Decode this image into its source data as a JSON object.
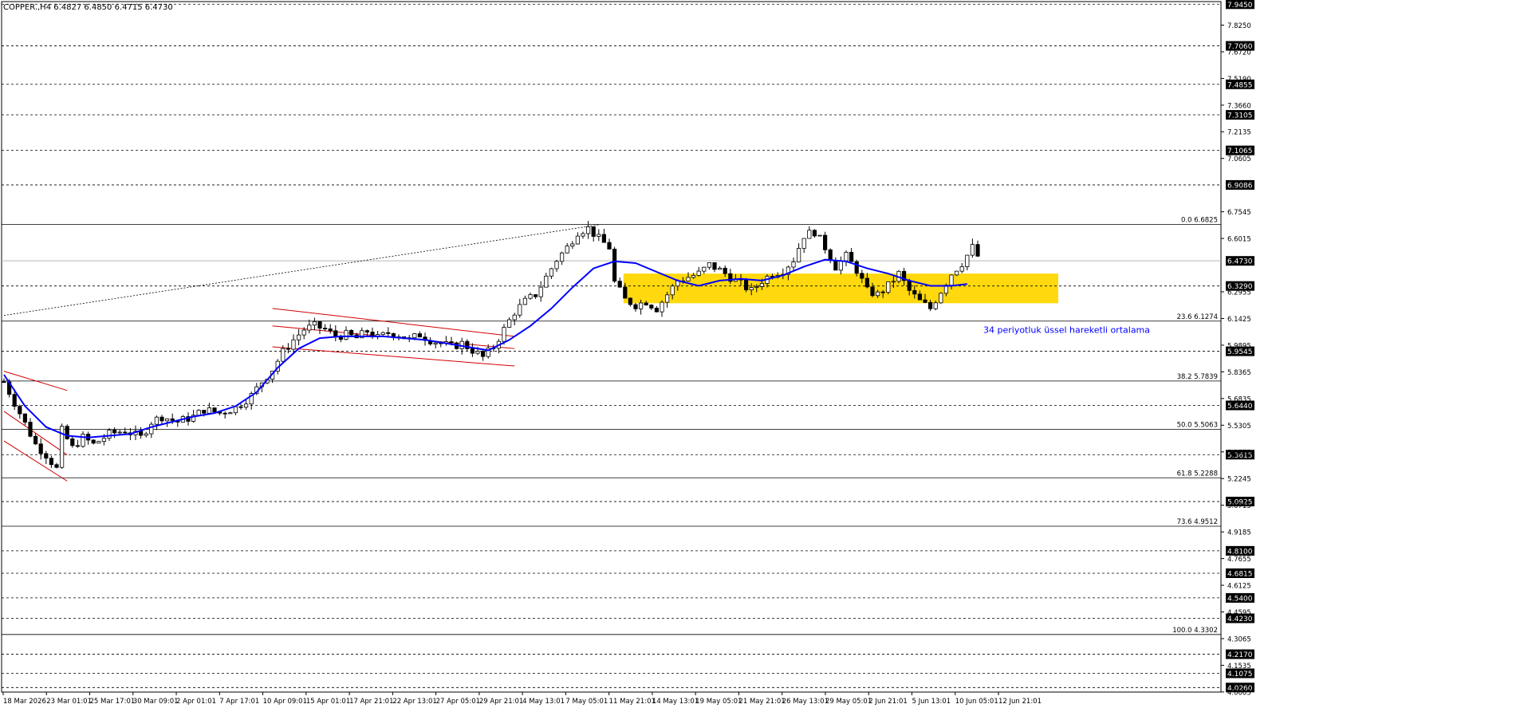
{
  "chart_data": {
    "type": "candlestick",
    "symbol_line": "COPPER.,H4 6.4827 6.4850 6.4715 6.4730",
    "ylim": [
      4.0,
      7.96
    ],
    "x_tick_labels": [
      "18 Mar 2026",
      "23 Mar 01:01",
      "25 Mar 17:01",
      "30 Mar 09:01",
      "2 Apr 01:01",
      "7 Apr 17:01",
      "10 Apr 09:01",
      "15 Apr 01:01",
      "17 Apr 21:01",
      "22 Apr 13:01",
      "27 Apr 05:01",
      "29 Apr 21:01",
      "4 May 13:01",
      "7 May 05:01",
      "11 May 21:01",
      "14 May 13:01",
      "19 May 05:01",
      "21 May 21:01",
      "26 May 13:01",
      "29 May 05:01",
      "2 Jun 21:01",
      "5 Jun 13:01",
      "10 Jun 05:01",
      "12 Jun 21:01"
    ],
    "y_tick_labels": [
      7.825,
      7.672,
      7.519,
      7.366,
      7.2135,
      7.0605,
      6.7545,
      6.6015,
      6.2955,
      6.1425,
      5.9895,
      5.8365,
      5.6835,
      5.5305,
      5.3775,
      5.2245,
      5.0715,
      4.9185,
      4.7655,
      4.6125,
      4.4595,
      4.3065,
      4.1535,
      4.0005
    ],
    "horizontal_levels": [
      {
        "value": 7.945,
        "label": "7.9450",
        "style": "dashed"
      },
      {
        "value": 7.706,
        "label": "7.7060",
        "style": "dashed"
      },
      {
        "value": 7.4855,
        "label": "7.4855",
        "style": "dashed"
      },
      {
        "value": 7.3105,
        "label": "7.3105",
        "style": "dashed"
      },
      {
        "value": 7.1065,
        "label": "7.1065",
        "style": "dashed"
      },
      {
        "value": 6.9086,
        "label": "6.9086",
        "style": "dashed"
      },
      {
        "value": 6.329,
        "label": "6.3290",
        "style": "dashed"
      },
      {
        "value": 5.9545,
        "label": "5.9545",
        "style": "dashed"
      },
      {
        "value": 5.644,
        "label": "5.6440",
        "style": "dashed"
      },
      {
        "value": 5.3615,
        "label": "5.3615",
        "style": "dashed"
      },
      {
        "value": 5.0925,
        "label": "5.0925",
        "style": "dashed"
      },
      {
        "value": 4.81,
        "label": "4.8100",
        "style": "dashed"
      },
      {
        "value": 4.6815,
        "label": "4.6815",
        "style": "dashed"
      },
      {
        "value": 4.54,
        "label": "4.5400",
        "style": "dashed"
      },
      {
        "value": 4.423,
        "label": "4.4230",
        "style": "dashed"
      },
      {
        "value": 4.217,
        "label": "4.2170",
        "style": "dashed"
      },
      {
        "value": 4.1075,
        "label": "4.1075",
        "style": "dashed"
      },
      {
        "value": 4.026,
        "label": "4.0260",
        "style": "dashed"
      }
    ],
    "fibonacci": [
      {
        "value": 6.6825,
        "label": "0.0 6.6825"
      },
      {
        "value": 6.1274,
        "label": "23.6 6.1274"
      },
      {
        "value": 5.7839,
        "label": "38.2 5.7839"
      },
      {
        "value": 5.5063,
        "label": "50.0 5.5063"
      },
      {
        "value": 5.2288,
        "label": "61.8 5.2288"
      },
      {
        "value": 4.9512,
        "label": "73.6 4.9512"
      },
      {
        "value": 4.3302,
        "label": "100.0 4.3302"
      }
    ],
    "last_price": {
      "value": 6.473,
      "label": "6.4730"
    },
    "ema_annotation": "34 periyotluk üssel hareketli ortalama",
    "close_path": [
      [
        0,
        5.78
      ],
      [
        3,
        5.6
      ],
      [
        6,
        5.42
      ],
      [
        8,
        5.36
      ],
      [
        10,
        5.28
      ],
      [
        11,
        5.5
      ],
      [
        13,
        5.4
      ],
      [
        15,
        5.46
      ],
      [
        17,
        5.42
      ],
      [
        20,
        5.48
      ],
      [
        23,
        5.5
      ],
      [
        26,
        5.46
      ],
      [
        28,
        5.55
      ],
      [
        30,
        5.58
      ],
      [
        33,
        5.55
      ],
      [
        36,
        5.58
      ],
      [
        38,
        5.62
      ],
      [
        41,
        5.6
      ],
      [
        44,
        5.63
      ],
      [
        47,
        5.7
      ],
      [
        49,
        5.78
      ],
      [
        51,
        5.85
      ],
      [
        53,
        5.95
      ],
      [
        55,
        6.02
      ],
      [
        57,
        6.08
      ],
      [
        59,
        6.1
      ],
      [
        61,
        6.08
      ],
      [
        63,
        6.04
      ],
      [
        65,
        6.05
      ],
      [
        67,
        6.03
      ],
      [
        69,
        6.07
      ],
      [
        71,
        6.03
      ],
      [
        73,
        6.06
      ],
      [
        75,
        6.05
      ],
      [
        77,
        6.02
      ],
      [
        79,
        6.05
      ],
      [
        81,
        6.02
      ],
      [
        83,
        6.0
      ],
      [
        85,
        5.98
      ],
      [
        87,
        6.0
      ],
      [
        89,
        5.96
      ],
      [
        91,
        5.92
      ],
      [
        93,
        5.98
      ],
      [
        95,
        6.08
      ],
      [
        97,
        6.18
      ],
      [
        99,
        6.24
      ],
      [
        101,
        6.28
      ],
      [
        103,
        6.38
      ],
      [
        105,
        6.48
      ],
      [
        107,
        6.55
      ],
      [
        109,
        6.64
      ],
      [
        111,
        6.66
      ],
      [
        113,
        6.6
      ],
      [
        115,
        6.55
      ],
      [
        116,
        6.35
      ],
      [
        118,
        6.25
      ],
      [
        120,
        6.22
      ],
      [
        122,
        6.24
      ],
      [
        124,
        6.2
      ],
      [
        126,
        6.28
      ],
      [
        128,
        6.36
      ],
      [
        130,
        6.38
      ],
      [
        132,
        6.4
      ],
      [
        134,
        6.45
      ],
      [
        136,
        6.42
      ],
      [
        138,
        6.38
      ],
      [
        140,
        6.34
      ],
      [
        142,
        6.3
      ],
      [
        144,
        6.36
      ],
      [
        146,
        6.4
      ],
      [
        148,
        6.42
      ],
      [
        150,
        6.48
      ],
      [
        152,
        6.62
      ],
      [
        154,
        6.64
      ],
      [
        156,
        6.55
      ],
      [
        158,
        6.44
      ],
      [
        160,
        6.5
      ],
      [
        162,
        6.42
      ],
      [
        164,
        6.3
      ],
      [
        166,
        6.28
      ],
      [
        168,
        6.33
      ],
      [
        170,
        6.4
      ],
      [
        172,
        6.3
      ],
      [
        174,
        6.24
      ],
      [
        176,
        6.2
      ],
      [
        178,
        6.3
      ],
      [
        180,
        6.4
      ],
      [
        182,
        6.46
      ],
      [
        184,
        6.55
      ],
      [
        185,
        6.5
      ]
    ],
    "series": [
      {
        "name": "34 periyotluk üssel hareketli ortalama",
        "color": "#0000ff",
        "values": [
          [
            0,
            5.82
          ],
          [
            4,
            5.64
          ],
          [
            8,
            5.52
          ],
          [
            12,
            5.47
          ],
          [
            16,
            5.46
          ],
          [
            20,
            5.47
          ],
          [
            24,
            5.48
          ],
          [
            28,
            5.52
          ],
          [
            32,
            5.55
          ],
          [
            36,
            5.58
          ],
          [
            40,
            5.6
          ],
          [
            44,
            5.64
          ],
          [
            48,
            5.72
          ],
          [
            52,
            5.86
          ],
          [
            56,
            5.97
          ],
          [
            60,
            6.03
          ],
          [
            64,
            6.04
          ],
          [
            68,
            6.04
          ],
          [
            72,
            6.04
          ],
          [
            76,
            6.03
          ],
          [
            80,
            6.02
          ],
          [
            84,
            6.0
          ],
          [
            88,
            5.98
          ],
          [
            92,
            5.96
          ],
          [
            96,
            6.02
          ],
          [
            100,
            6.1
          ],
          [
            104,
            6.2
          ],
          [
            108,
            6.32
          ],
          [
            112,
            6.43
          ],
          [
            116,
            6.47
          ],
          [
            120,
            6.46
          ],
          [
            124,
            6.41
          ],
          [
            128,
            6.36
          ],
          [
            132,
            6.33
          ],
          [
            136,
            6.36
          ],
          [
            140,
            6.37
          ],
          [
            144,
            6.36
          ],
          [
            148,
            6.39
          ],
          [
            152,
            6.44
          ],
          [
            156,
            6.48
          ],
          [
            160,
            6.47
          ],
          [
            164,
            6.43
          ],
          [
            168,
            6.4
          ],
          [
            172,
            6.36
          ],
          [
            176,
            6.33
          ],
          [
            180,
            6.33
          ],
          [
            183,
            6.34
          ]
        ]
      }
    ],
    "candles_count": 186,
    "zone": {
      "x_start": 118,
      "x_end": 200,
      "y_low": 6.23,
      "y_high": 6.4,
      "color": "#ffd700"
    },
    "channels": [
      {
        "color": "#d00000",
        "lines": [
          [
            [
              0,
              5.84
            ],
            [
              12,
              5.73
            ]
          ],
          [
            [
              0,
              5.61
            ],
            [
              12,
              5.36
            ]
          ],
          [
            [
              0,
              5.44
            ],
            [
              12,
              5.21
            ]
          ]
        ]
      },
      {
        "color": "#d00000",
        "lines": [
          [
            [
              51,
              6.2
            ],
            [
              97,
              6.04
            ]
          ],
          [
            [
              51,
              6.1
            ],
            [
              97,
              5.97
            ]
          ],
          [
            [
              51,
              5.98
            ],
            [
              97,
              5.87
            ]
          ]
        ]
      }
    ],
    "trendline": {
      "color": "#000000",
      "points": [
        [
          0,
          6.16
        ],
        [
          113,
          6.68
        ]
      ]
    },
    "colors": {
      "background": "#ffffff",
      "grid": "#000000",
      "up_candle": "#000000",
      "down_candle": "#000000",
      "ema": "#0000ff",
      "channel": "#d00000",
      "zone": "#ffd700",
      "annotation": "#0000ff"
    }
  }
}
